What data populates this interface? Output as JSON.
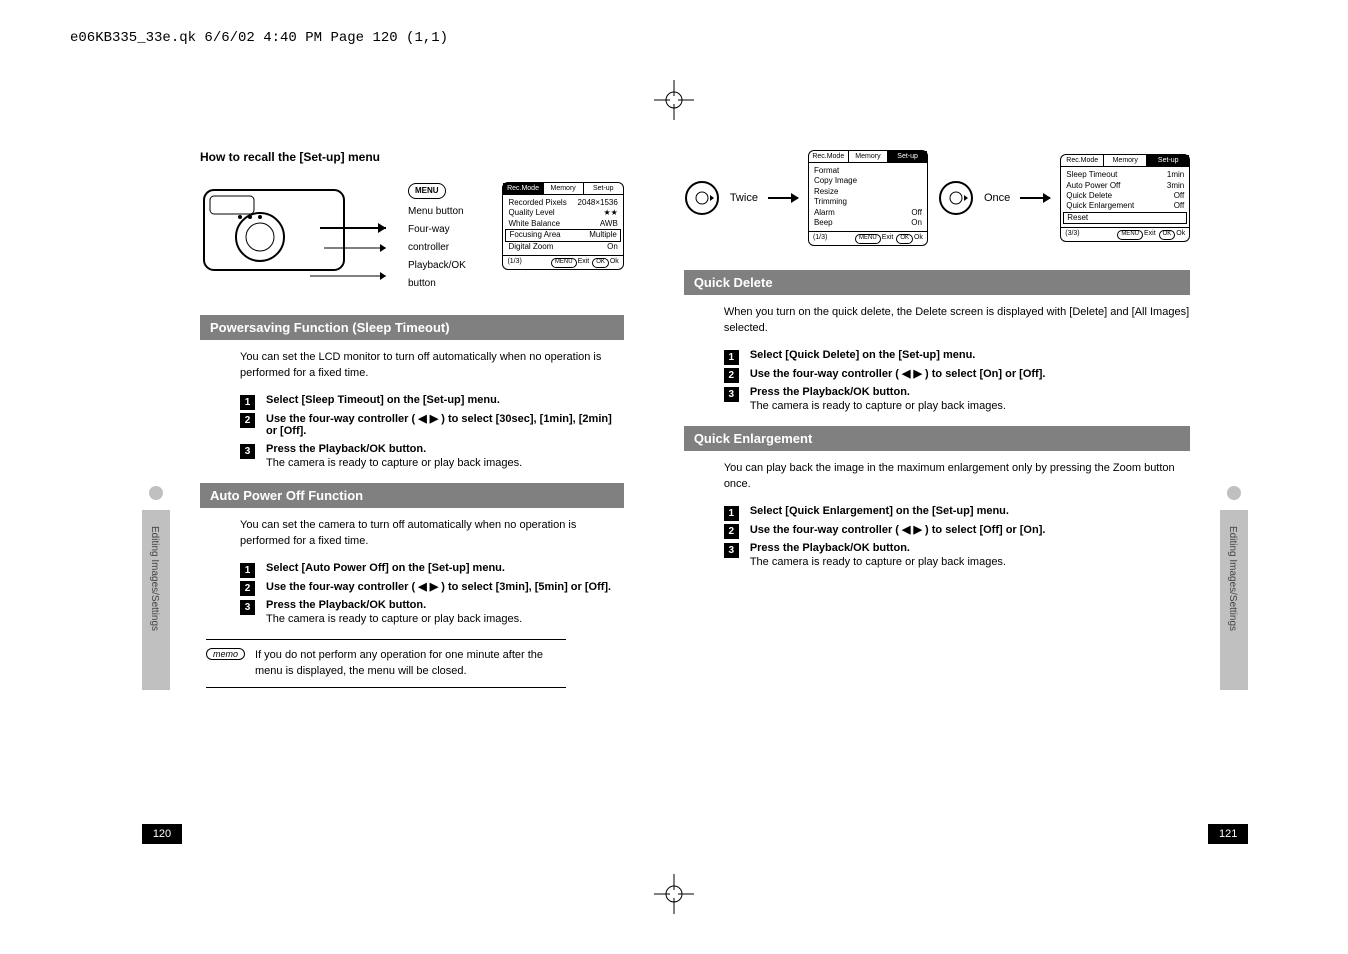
{
  "pdf_header": "e06KB335_33e.qk  6/6/02  4:40 PM  Page 120  (1,1)",
  "side_tab_label": "Editing Images/Settings",
  "page_left_num": "120",
  "page_right_num": "121",
  "left": {
    "recall_title": "How to recall the [Set-up] menu",
    "callouts": {
      "menu_pill": "MENU",
      "menu_btn": "Menu button",
      "fourway": "Four-way controller",
      "playback": "Playback/OK button"
    },
    "lcd1": {
      "tabs": [
        "Rec.Mode",
        "Memory",
        "Set-up"
      ],
      "rows": [
        [
          "Recorded Pixels",
          "2048×1536"
        ],
        [
          "Quality Level",
          "★★"
        ],
        [
          "White Balance",
          "AWB"
        ],
        [
          "Focusing Area",
          "Multiple"
        ],
        [
          "Digital Zoom",
          "On"
        ]
      ],
      "page": "(1/3)",
      "foot_exit": "Exit",
      "foot_ok": "Ok"
    },
    "sec1": {
      "title": "Powersaving Function (Sleep Timeout)",
      "intro": "You can set the LCD monitor to turn off automatically when no operation is performed for a fixed time.",
      "steps": [
        {
          "b": "Select [Sleep Timeout] on the [Set-up] menu."
        },
        {
          "b": "Use the four-way controller ( ◀  ▶ ) to select [30sec], [1min], [2min] or [Off]."
        },
        {
          "b": "Press the Playback/OK button.",
          "s": "The camera is ready to capture or play back images."
        }
      ]
    },
    "sec2": {
      "title": "Auto Power Off Function",
      "intro": "You can set the camera to turn off automatically when no operation is performed for a fixed time.",
      "steps": [
        {
          "b": "Select [Auto Power Off] on the [Set-up] menu."
        },
        {
          "b": "Use the four-way controller ( ◀  ▶ ) to select [3min], [5min] or [Off]."
        },
        {
          "b": "Press the Playback/OK button.",
          "s": "The camera is ready to capture or play back images."
        }
      ],
      "memo": "If you do not perform any operation for one minute after the menu is displayed, the menu will be closed.",
      "memo_label": "memo"
    }
  },
  "right": {
    "nav_twice": "Twice",
    "nav_once": "Once",
    "lcd2": {
      "tabs": [
        "Rec.Mode",
        "Memory",
        "Set-up"
      ],
      "rows": [
        [
          "Format",
          ""
        ],
        [
          "Copy Image",
          ""
        ],
        [
          "Resize",
          ""
        ],
        [
          "Trimming",
          ""
        ],
        [
          "Alarm",
          "Off"
        ],
        [
          "Beep",
          "On"
        ]
      ],
      "page": "(1/3)",
      "foot_exit": "Exit",
      "foot_ok": "Ok"
    },
    "lcd3": {
      "tabs": [
        "Rec.Mode",
        "Memory",
        "Set-up"
      ],
      "rows": [
        [
          "Sleep Timeout",
          "1min"
        ],
        [
          "Auto Power Off",
          "3min"
        ],
        [
          "Quick Delete",
          "Off"
        ],
        [
          "Quick Enlargement",
          "Off"
        ],
        [
          "Reset",
          ""
        ]
      ],
      "page": "(3/3)",
      "foot_exit": "Exit",
      "foot_ok": "Ok"
    },
    "sec1": {
      "title": "Quick Delete",
      "intro": "When you turn on the quick delete, the Delete screen is displayed with [Delete] and [All Images] selected.",
      "steps": [
        {
          "b": "Select [Quick Delete] on the [Set-up] menu."
        },
        {
          "b": "Use the four-way controller ( ◀  ▶ ) to select [On] or [Off]."
        },
        {
          "b": "Press the Playback/OK button.",
          "s": "The camera is ready to capture or play back images."
        }
      ]
    },
    "sec2": {
      "title": "Quick Enlargement",
      "intro": "You can play back the image in the maximum enlargement only by pressing the Zoom button once.",
      "steps": [
        {
          "b": "Select [Quick Enlargement] on the [Set-up] menu."
        },
        {
          "b": "Use the four-way controller ( ◀  ▶ ) to select [Off] or [On]."
        },
        {
          "b": "Press the Playback/OK button.",
          "s": "The camera is ready to capture or play back images."
        }
      ]
    }
  }
}
